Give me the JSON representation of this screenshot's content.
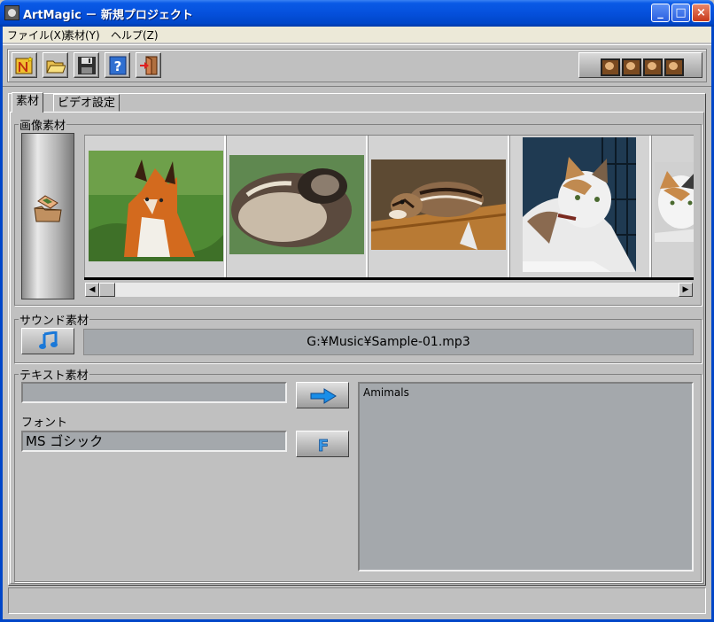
{
  "window": {
    "title": "ArtMagic － 新規プロジェクト",
    "controls": {
      "minimize": "_",
      "maximize": "□",
      "close": "×"
    }
  },
  "menu": {
    "items": [
      {
        "label": "ファイル(X)"
      },
      {
        "label": "素材(Y)"
      },
      {
        "label": "ヘルプ(Z)"
      }
    ]
  },
  "toolbar": {
    "buttons": [
      {
        "icon": "new-project-icon"
      },
      {
        "icon": "open-folder-icon"
      },
      {
        "icon": "save-disk-icon"
      },
      {
        "icon": "help-icon"
      },
      {
        "icon": "exit-icon"
      }
    ],
    "film_icon": "filmstrip-icon"
  },
  "tabs": [
    {
      "label": "素材",
      "active": true
    },
    {
      "label": "ビデオ設定",
      "active": false
    }
  ],
  "image_section": {
    "legend": "画像素材",
    "thumbnails": [
      {
        "subject": "fox"
      },
      {
        "subject": "sleeping-cat"
      },
      {
        "subject": "chipmunk"
      },
      {
        "subject": "calico-cat"
      },
      {
        "subject": "calico-cat-partial"
      }
    ],
    "scroll_left": "◀",
    "scroll_right": "▶"
  },
  "sound_section": {
    "legend": "サウンド素材",
    "file_path": "G:¥Music¥Sample-01.mp3"
  },
  "text_section": {
    "legend": "テキスト素材",
    "text_value": "",
    "font_label": "フォント",
    "font_value": "MS ゴシック",
    "preview_text": "Amimals"
  },
  "colors": {
    "titlebar": "#0550dc",
    "face": "#c0c0c0",
    "field": "#a4a8ac"
  }
}
